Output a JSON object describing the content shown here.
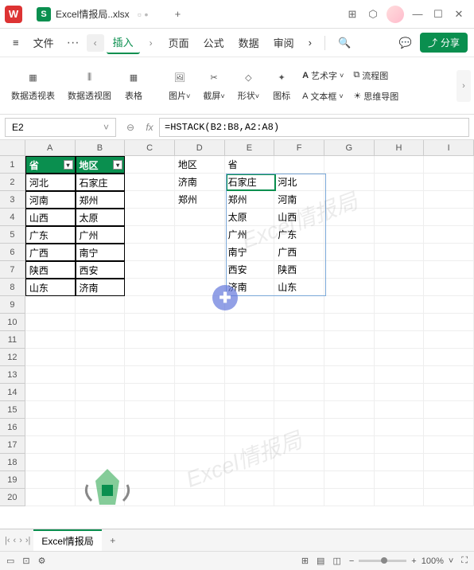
{
  "titlebar": {
    "app_letter": "W",
    "file_letter": "S",
    "filename": "Excel情报局..xlsx",
    "add_tab": "+"
  },
  "menubar": {
    "hamburger": "≡",
    "file": "文件",
    "dots": "···",
    "nav_prev": "‹",
    "nav_next": "›",
    "items": [
      "插入",
      "页面",
      "公式",
      "数据",
      "审阅"
    ],
    "more": "›",
    "search": "🔍",
    "cloud": "💬",
    "share": "分享"
  },
  "ribbon": {
    "items": [
      {
        "label": "数据透视表"
      },
      {
        "label": "数据透视图"
      },
      {
        "label": "表格"
      },
      {
        "label": "图片"
      },
      {
        "label": "截屏"
      },
      {
        "label": "形状"
      },
      {
        "label": "图标"
      }
    ],
    "small": [
      {
        "icon": "A",
        "label": "艺术字"
      },
      {
        "icon": "A",
        "label": "文本框"
      },
      {
        "icon": "⧉",
        "label": "流程图"
      },
      {
        "icon": "☀",
        "label": "思维导图"
      }
    ]
  },
  "fx": {
    "cellref": "E2",
    "fxlabel": "fx",
    "formula": "=HSTACK(B2:B8,A2:A8)"
  },
  "cols": [
    "A",
    "B",
    "C",
    "D",
    "E",
    "F",
    "G",
    "H",
    "I"
  ],
  "rownums": [
    "1",
    "2",
    "3",
    "4",
    "5",
    "6",
    "7",
    "8",
    "9",
    "10",
    "11",
    "12",
    "13",
    "14",
    "15",
    "16",
    "17",
    "18",
    "19",
    "20"
  ],
  "table": {
    "h1": "省",
    "h2": "地区",
    "rows": [
      [
        "河北",
        "石家庄"
      ],
      [
        "河南",
        "郑州"
      ],
      [
        "山西",
        "太原"
      ],
      [
        "广东",
        "广州"
      ],
      [
        "广西",
        "南宁"
      ],
      [
        "陕西",
        "西安"
      ],
      [
        "山东",
        "济南"
      ]
    ]
  },
  "colD": [
    "地区",
    "济南",
    "郑州"
  ],
  "colE": [
    "省",
    "石家庄",
    "郑州",
    "太原",
    "广州",
    "南宁",
    "西安",
    "济南"
  ],
  "colF": [
    "",
    "河北",
    "河南",
    "山西",
    "广东",
    "广西",
    "陕西",
    "山东"
  ],
  "watermark": "Excel情报局",
  "sheet": {
    "name": "Excel情报局",
    "add": "+"
  },
  "status": {
    "zoom": "100%"
  }
}
